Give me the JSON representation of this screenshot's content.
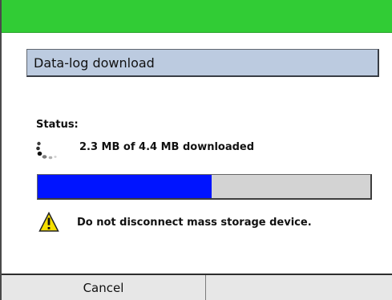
{
  "dialog": {
    "title": "Data-log download",
    "status_label": "Status:",
    "download_status": "2.3 MB of 4.4 MB downloaded",
    "warning": "Do not disconnect mass storage device."
  },
  "progress": {
    "downloaded_mb": 2.3,
    "total_mb": 4.4,
    "fraction": 0.523
  },
  "softkeys": {
    "left_label": "Cancel",
    "right_label": ""
  },
  "icons": {
    "download": "busy-spinner-icon",
    "warning": "warning-triangle-icon"
  },
  "colors": {
    "status_strip": "#31cc35",
    "title_bar": "#bccbe0",
    "progress_fill": "#0014ff",
    "progress_track": "#d3d3d3",
    "warning_yellow": "#f6df00"
  }
}
